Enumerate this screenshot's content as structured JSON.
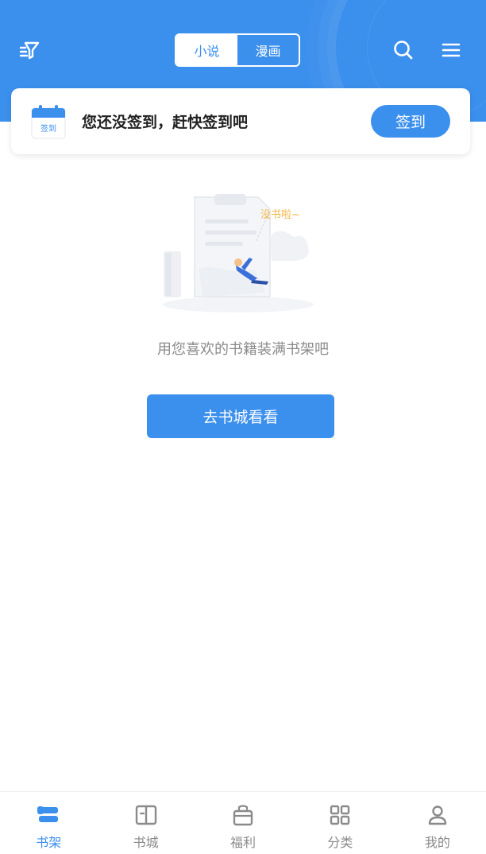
{
  "colors": {
    "primary": "#3b8fed",
    "text_dark": "#222222",
    "text_muted": "#8a8a8a",
    "background": "#ffffff"
  },
  "header": {
    "tabs": [
      {
        "label": "小说",
        "active": true
      },
      {
        "label": "漫画",
        "active": false
      }
    ],
    "icons": {
      "left": "filter-icon",
      "search": "search-icon",
      "menu": "menu-icon"
    }
  },
  "checkin": {
    "calendar_label": "签到",
    "message": "您还没签到，赶快签到吧",
    "button_label": "签到"
  },
  "empty_state": {
    "illustration_caption": "没书啦~",
    "message": "用您喜欢的书籍装满书架吧",
    "button_label": "去书城看看"
  },
  "bottom_nav": {
    "items": [
      {
        "label": "书架",
        "icon": "bookshelf-icon",
        "active": true
      },
      {
        "label": "书城",
        "icon": "book-open-icon",
        "active": false
      },
      {
        "label": "福利",
        "icon": "gift-icon",
        "active": false
      },
      {
        "label": "分类",
        "icon": "grid-icon",
        "active": false
      },
      {
        "label": "我的",
        "icon": "user-icon",
        "active": false
      }
    ]
  }
}
